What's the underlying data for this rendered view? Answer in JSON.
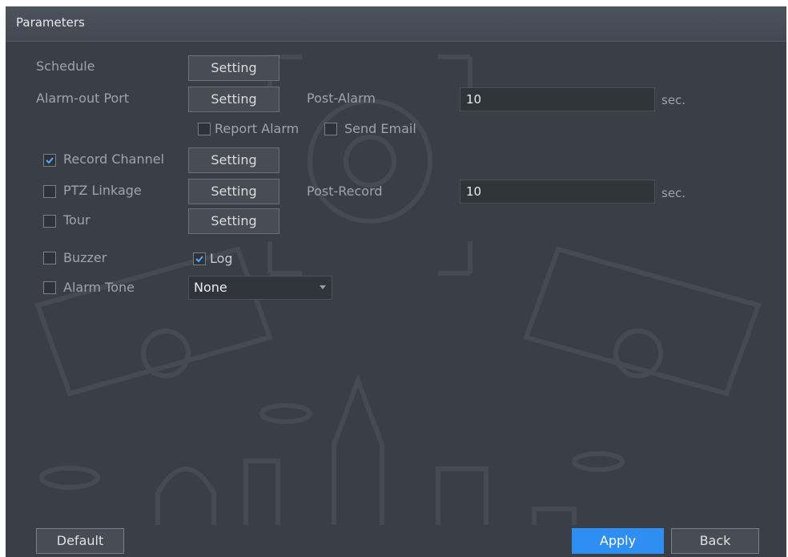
{
  "title": "Parameters",
  "rows": {
    "schedule": {
      "label": "Schedule",
      "button": "Setting"
    },
    "alarm_out": {
      "label": "Alarm-out Port",
      "button": "Setting",
      "post_label": "Post-Alarm",
      "post_value": "10",
      "unit": "sec."
    },
    "report_alarm": {
      "label": "Report Alarm",
      "checked": false
    },
    "send_email": {
      "label": "Send Email",
      "checked": false
    },
    "record_channel": {
      "label": "Record Channel",
      "checked": true,
      "button": "Setting"
    },
    "ptz_linkage": {
      "label": "PTZ Linkage",
      "checked": false,
      "button": "Setting",
      "post_label": "Post-Record",
      "post_value": "10",
      "unit": "sec."
    },
    "tour": {
      "label": "Tour",
      "checked": false,
      "button": "Setting"
    },
    "buzzer": {
      "label": "Buzzer",
      "checked": false
    },
    "log": {
      "label": "Log",
      "checked": true
    },
    "alarm_tone": {
      "label": "Alarm Tone",
      "checked": false,
      "value": "None"
    }
  },
  "footer": {
    "default": "Default",
    "apply": "Apply",
    "back": "Back"
  },
  "colors": {
    "background": "#3a3f47",
    "accent": "#2e8ef2",
    "check": "#5aa6ff"
  }
}
